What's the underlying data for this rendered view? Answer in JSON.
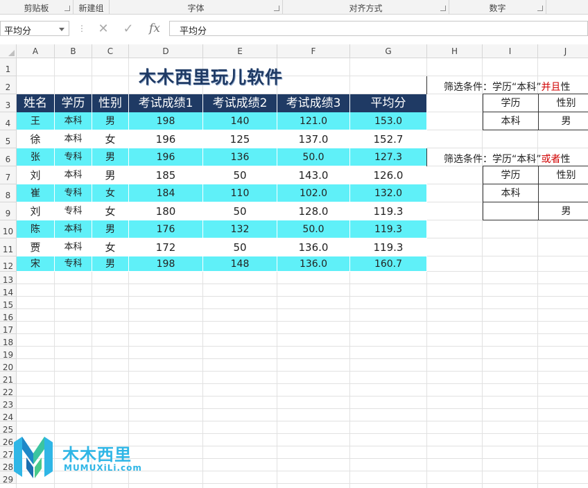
{
  "ribbon": {
    "groups": [
      "剪贴板",
      "新建组",
      "字体",
      "对齐方式",
      "数字"
    ]
  },
  "formula_bar": {
    "name_box": "平均分",
    "cancel_icon": "✕",
    "enter_icon": "✓",
    "fx_label": "fx",
    "content": "平均分"
  },
  "columns": [
    "A",
    "B",
    "C",
    "D",
    "E",
    "F",
    "G",
    "H",
    "I",
    "J"
  ],
  "rows": [
    "1",
    "2",
    "3",
    "4",
    "5",
    "6",
    "7",
    "8",
    "9",
    "10",
    "11",
    "12",
    "13",
    "14",
    "15",
    "16",
    "17",
    "18",
    "19",
    "20",
    "21",
    "22",
    "23",
    "24",
    "25",
    "26",
    "27",
    "28",
    "29"
  ],
  "sheet": {
    "title": "木木西里玩儿软件",
    "headers": [
      "姓名",
      "学历",
      "性别",
      "考试成绩1",
      "考试成绩2",
      "考试成绩3",
      "平均分"
    ],
    "rows": [
      [
        "王",
        "本科",
        "男",
        "198",
        "140",
        "121.0",
        "153.0"
      ],
      [
        "徐",
        "本科",
        "女",
        "196",
        "125",
        "137.0",
        "152.7"
      ],
      [
        "张",
        "专科",
        "男",
        "196",
        "136",
        "50.0",
        "127.3"
      ],
      [
        "刘",
        "本科",
        "男",
        "185",
        "50",
        "143.0",
        "126.0"
      ],
      [
        "崔",
        "专科",
        "女",
        "184",
        "110",
        "102.0",
        "132.0"
      ],
      [
        "刘",
        "专科",
        "女",
        "180",
        "50",
        "128.0",
        "119.3"
      ],
      [
        "陈",
        "本科",
        "男",
        "176",
        "132",
        "50.0",
        "119.3"
      ],
      [
        "贾",
        "本科",
        "女",
        "172",
        "50",
        "136.0",
        "119.3"
      ],
      [
        "宋",
        "专科",
        "男",
        "198",
        "148",
        "136.0",
        "160.7"
      ]
    ],
    "highlight_rows": [
      0,
      2,
      4,
      6,
      8
    ],
    "colors": {
      "header_bg": "#1f3a64",
      "header_text": "#ffffff",
      "highlight": "#5ff0f8",
      "condition_red": "#d00000"
    }
  },
  "criteria_and": {
    "prefix": "筛选条件：学历“本科”",
    "keyword": "并且",
    "suffix": "性",
    "table": [
      [
        "学历",
        "性别"
      ],
      [
        "本科",
        "男"
      ]
    ]
  },
  "criteria_or": {
    "prefix": "筛选条件：学历“本科”",
    "keyword": "或者",
    "suffix": "性",
    "table": [
      [
        "学历",
        "性别"
      ],
      [
        "本科",
        ""
      ],
      [
        "",
        "男"
      ]
    ]
  },
  "logo": {
    "cn_text": "木木西里",
    "en_text": "MUMUXiLi.com"
  }
}
